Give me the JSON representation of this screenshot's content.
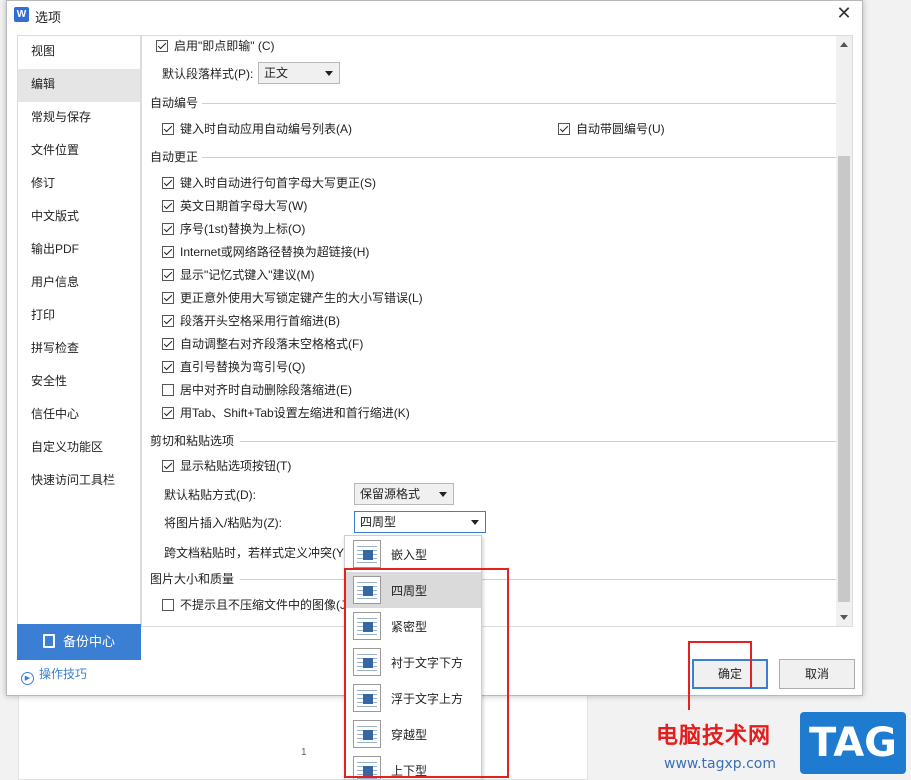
{
  "window": {
    "title": "选项",
    "app_icon": "W"
  },
  "nav": {
    "items": [
      "视图",
      "编辑",
      "常规与保存",
      "文件位置",
      "修订",
      "中文版式",
      "输出PDF",
      "用户信息",
      "打印",
      "拼写检查",
      "安全性",
      "信任中心",
      "自定义功能区",
      "快速访问工具栏"
    ],
    "selected": 1,
    "backup_label": "备份中心",
    "tips_label": "操作技巧"
  },
  "panel": {
    "top_checkbox": {
      "label": "启用\"即点即输\" (C)",
      "checked": true
    },
    "para_style": {
      "label": "默认段落样式(P):",
      "value": "正文"
    },
    "auto_number": {
      "title": "自动编号",
      "left": {
        "label": "键入时自动应用自动编号列表(A)",
        "checked": true
      },
      "right": {
        "label": "自动带圆编号(U)",
        "checked": true
      }
    },
    "autocorrect": {
      "title": "自动更正",
      "items": [
        {
          "label": "键入时自动进行句首字母大写更正(S)",
          "checked": true
        },
        {
          "label": "英文日期首字母大写(W)",
          "checked": true
        },
        {
          "label": "序号(1st)替换为上标(O)",
          "checked": true
        },
        {
          "label": "Internet或网络路径替换为超链接(H)",
          "checked": true
        },
        {
          "label": "显示\"记忆式键入\"建议(M)",
          "checked": true
        },
        {
          "label": "更正意外使用大写锁定键产生的大小写错误(L)",
          "checked": true
        },
        {
          "label": "段落开头空格采用行首缩进(B)",
          "checked": true
        },
        {
          "label": "自动调整右对齐段落末空格格式(F)",
          "checked": true
        },
        {
          "label": "直引号替换为弯引号(Q)",
          "checked": true
        },
        {
          "label": "居中对齐时自动删除段落缩进(E)",
          "checked": false
        },
        {
          "label": "用Tab、Shift+Tab设置左缩进和首行缩进(K)",
          "checked": true
        }
      ]
    },
    "paste": {
      "title": "剪切和粘贴选项",
      "show_button": {
        "label": "显示粘贴选项按钮(T)",
        "checked": true
      },
      "default_label": "默认粘贴方式(D):",
      "default_value": "保留源格式",
      "image_label": "将图片插入/粘贴为(Z):",
      "image_value": "四周型",
      "cross_label": "跨文档粘贴时，若样式定义冲突(Y):"
    },
    "image_quality": {
      "title": "图片大小和质量",
      "no_compress": {
        "label": "不提示且不压缩文件中的图像(J)",
        "checked": false
      }
    }
  },
  "dropdown": {
    "options": [
      "嵌入型",
      "四周型",
      "紧密型",
      "衬于文字下方",
      "浮于文字上方",
      "穿越型",
      "上下型"
    ],
    "highlighted": 1
  },
  "buttons": {
    "ok": "确定",
    "cancel": "取消"
  },
  "background_doc": {
    "page_number": "1"
  },
  "watermark": {
    "text": "电脑技术网",
    "url": "www.tagxp.com",
    "tag": "TAG"
  },
  "colors": {
    "accent": "#3b7fd5",
    "annotation_red": "#e42020"
  }
}
